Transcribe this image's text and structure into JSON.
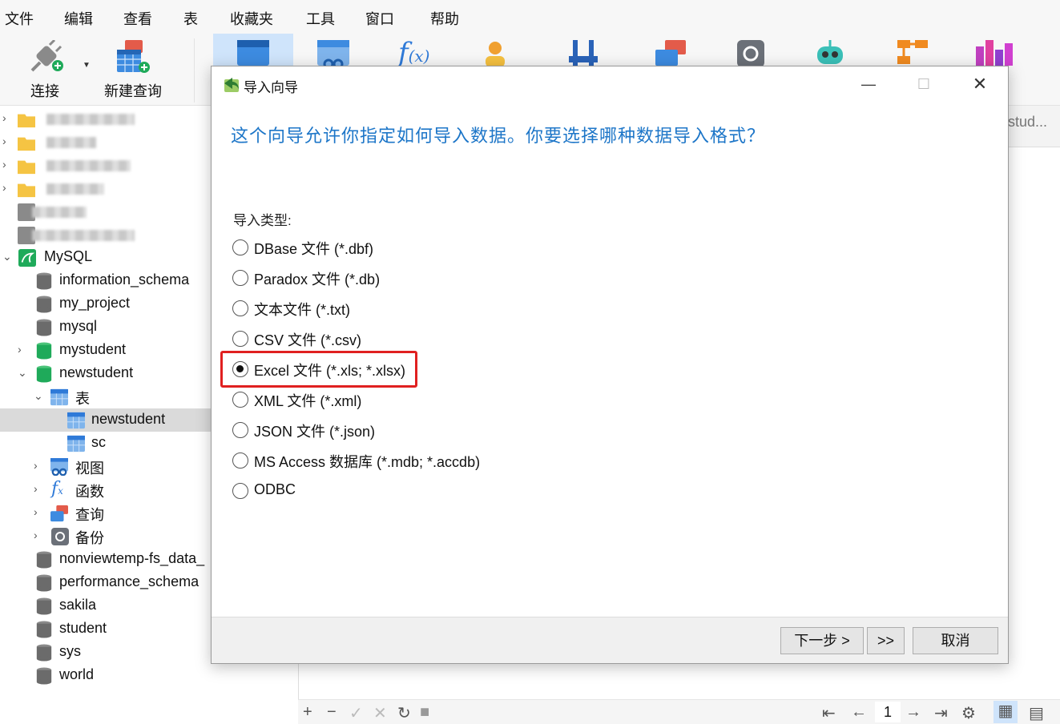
{
  "menu": [
    "文件",
    "编辑",
    "查看",
    "表",
    "收藏夹",
    "工具",
    "窗口",
    "帮助"
  ],
  "toolbar": {
    "connect_label": "连接",
    "new_query_label": "新建查询"
  },
  "tree": {
    "mysql_label": "MySQL",
    "databases_top": [
      "information_schema",
      "my_project",
      "mysql",
      "mystudent"
    ],
    "open_db": "newstudent",
    "tables_folder": "表",
    "tables": [
      "newstudent",
      "sc"
    ],
    "subfolders": [
      "视图",
      "函数",
      "查询",
      "备份"
    ],
    "databases_bottom": [
      "nonviewtemp-fs_data_",
      "performance_schema",
      "sakila",
      "student",
      "sys",
      "world"
    ]
  },
  "background": {
    "tab_text": "stud...",
    "page_number": "1"
  },
  "dialog": {
    "title": "导入向导",
    "heading": "这个向导允许你指定如何导入数据。你要选择哪种数据导入格式？",
    "type_label": "导入类型:",
    "options": [
      {
        "label": "DBase 文件 (*.dbf)",
        "selected": false
      },
      {
        "label": "Paradox 文件 (*.db)",
        "selected": false
      },
      {
        "label": "文本文件 (*.txt)",
        "selected": false
      },
      {
        "label": "CSV 文件 (*.csv)",
        "selected": false
      },
      {
        "label": "Excel 文件 (*.xls; *.xlsx)",
        "selected": true
      },
      {
        "label": "XML 文件 (*.xml)",
        "selected": false
      },
      {
        "label": "JSON 文件 (*.json)",
        "selected": false
      },
      {
        "label": "MS Access 数据库 (*.mdb; *.accdb)",
        "selected": false
      },
      {
        "label": "ODBC",
        "selected": false
      }
    ],
    "next_label": "下一步 >",
    "skip_label": ">>",
    "cancel_label": "取消"
  },
  "colors": {
    "accent_blue": "#1d76c8",
    "highlight_red": "#e02020",
    "db_green": "#1faa5a",
    "db_gray": "#6b6b6b"
  }
}
